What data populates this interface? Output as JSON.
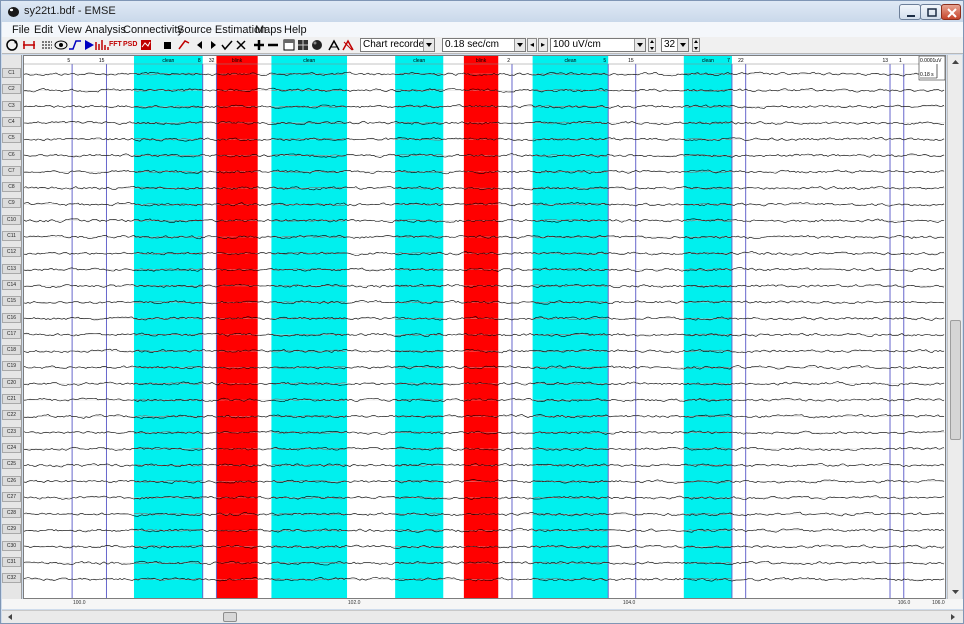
{
  "window": {
    "title": "sy22t1.bdf - EMSE",
    "controls": {
      "minimize": "minimize",
      "maximize": "maximize",
      "close": "close"
    }
  },
  "menu": [
    "File",
    "Edit",
    "View",
    "Analysis",
    "Connectivity",
    "Source Estimation",
    "Maps",
    "Help"
  ],
  "toolbar": {
    "icons": [
      "redraw-icon",
      "marker-icon",
      "montage-icon",
      "eye-icon",
      "filter-icon",
      "play-icon",
      "spectrum-icon",
      "fft-icon",
      "psd-icon",
      "topo-icon",
      "stop-icon",
      "tag-icon",
      "prev-icon",
      "next-icon",
      "accept-icon",
      "reject-icon",
      "zoom-in-icon",
      "zoom-out-icon",
      "window-icon",
      "grid-icon",
      "sphere-icon",
      "lasso-icon",
      "lasso-red-icon"
    ],
    "fft_label": "FFT",
    "psd_label": "PSD",
    "display_mode": "Chart recorder",
    "time_scale": "0.18 sec/cm",
    "amplitude_scale": "100 uV/cm",
    "channels_shown": "32"
  },
  "channels": [
    "C1",
    "C2",
    "C3",
    "C4",
    "C5",
    "C6",
    "C7",
    "C8",
    "C9",
    "C10",
    "C11",
    "C12",
    "C13",
    "C14",
    "C15",
    "C16",
    "C17",
    "C18",
    "C19",
    "C20",
    "C21",
    "C22",
    "C23",
    "C24",
    "C25",
    "C26",
    "C27",
    "C28",
    "C29",
    "C30",
    "C31",
    "C32"
  ],
  "scale_box": {
    "amplitude": "0.0001uV",
    "time": "0.18 s"
  },
  "epochs": [
    {
      "label": "clean",
      "type": "clean",
      "start": 100.4,
      "end": 100.9
    },
    {
      "label": "blink",
      "type": "blink",
      "start": 101.0,
      "end": 101.3
    },
    {
      "label": "clean",
      "type": "clean",
      "start": 101.4,
      "end": 101.95
    },
    {
      "label": "clean",
      "type": "clean",
      "start": 102.3,
      "end": 102.65
    },
    {
      "label": "blink",
      "type": "blink",
      "start": 102.8,
      "end": 103.05
    },
    {
      "label": "clean",
      "type": "clean",
      "start": 103.3,
      "end": 103.85
    },
    {
      "label": "clean",
      "type": "clean",
      "start": 104.4,
      "end": 104.75
    }
  ],
  "event_markers": [
    {
      "label": "5",
      "time": 99.95
    },
    {
      "label": "15",
      "time": 100.2
    },
    {
      "label": "8",
      "time": 100.9
    },
    {
      "label": "32",
      "time": 101.0
    },
    {
      "label": "2",
      "time": 103.15
    },
    {
      "label": "5",
      "time": 103.85
    },
    {
      "label": "15",
      "time": 104.05
    },
    {
      "label": "7",
      "time": 104.75
    },
    {
      "label": "22",
      "time": 104.85
    },
    {
      "label": "13",
      "time": 105.9
    },
    {
      "label": "1",
      "time": 106.0
    }
  ],
  "colors": {
    "clean": "#00f0ee",
    "blink": "#ff0000",
    "marker": "#6666cc",
    "trace": "#000000",
    "artifact_trace": "#cc0000"
  },
  "time_axis": {
    "range": [
      99.6,
      106.3
    ],
    "ticks": [
      {
        "time": 100.0,
        "label": "100.0"
      },
      {
        "time": 102.0,
        "label": "102.0"
      },
      {
        "time": 104.0,
        "label": "104.0"
      },
      {
        "time": 106.0,
        "label": "106.0"
      },
      {
        "time": 106.25,
        "label": "106.0"
      }
    ]
  }
}
